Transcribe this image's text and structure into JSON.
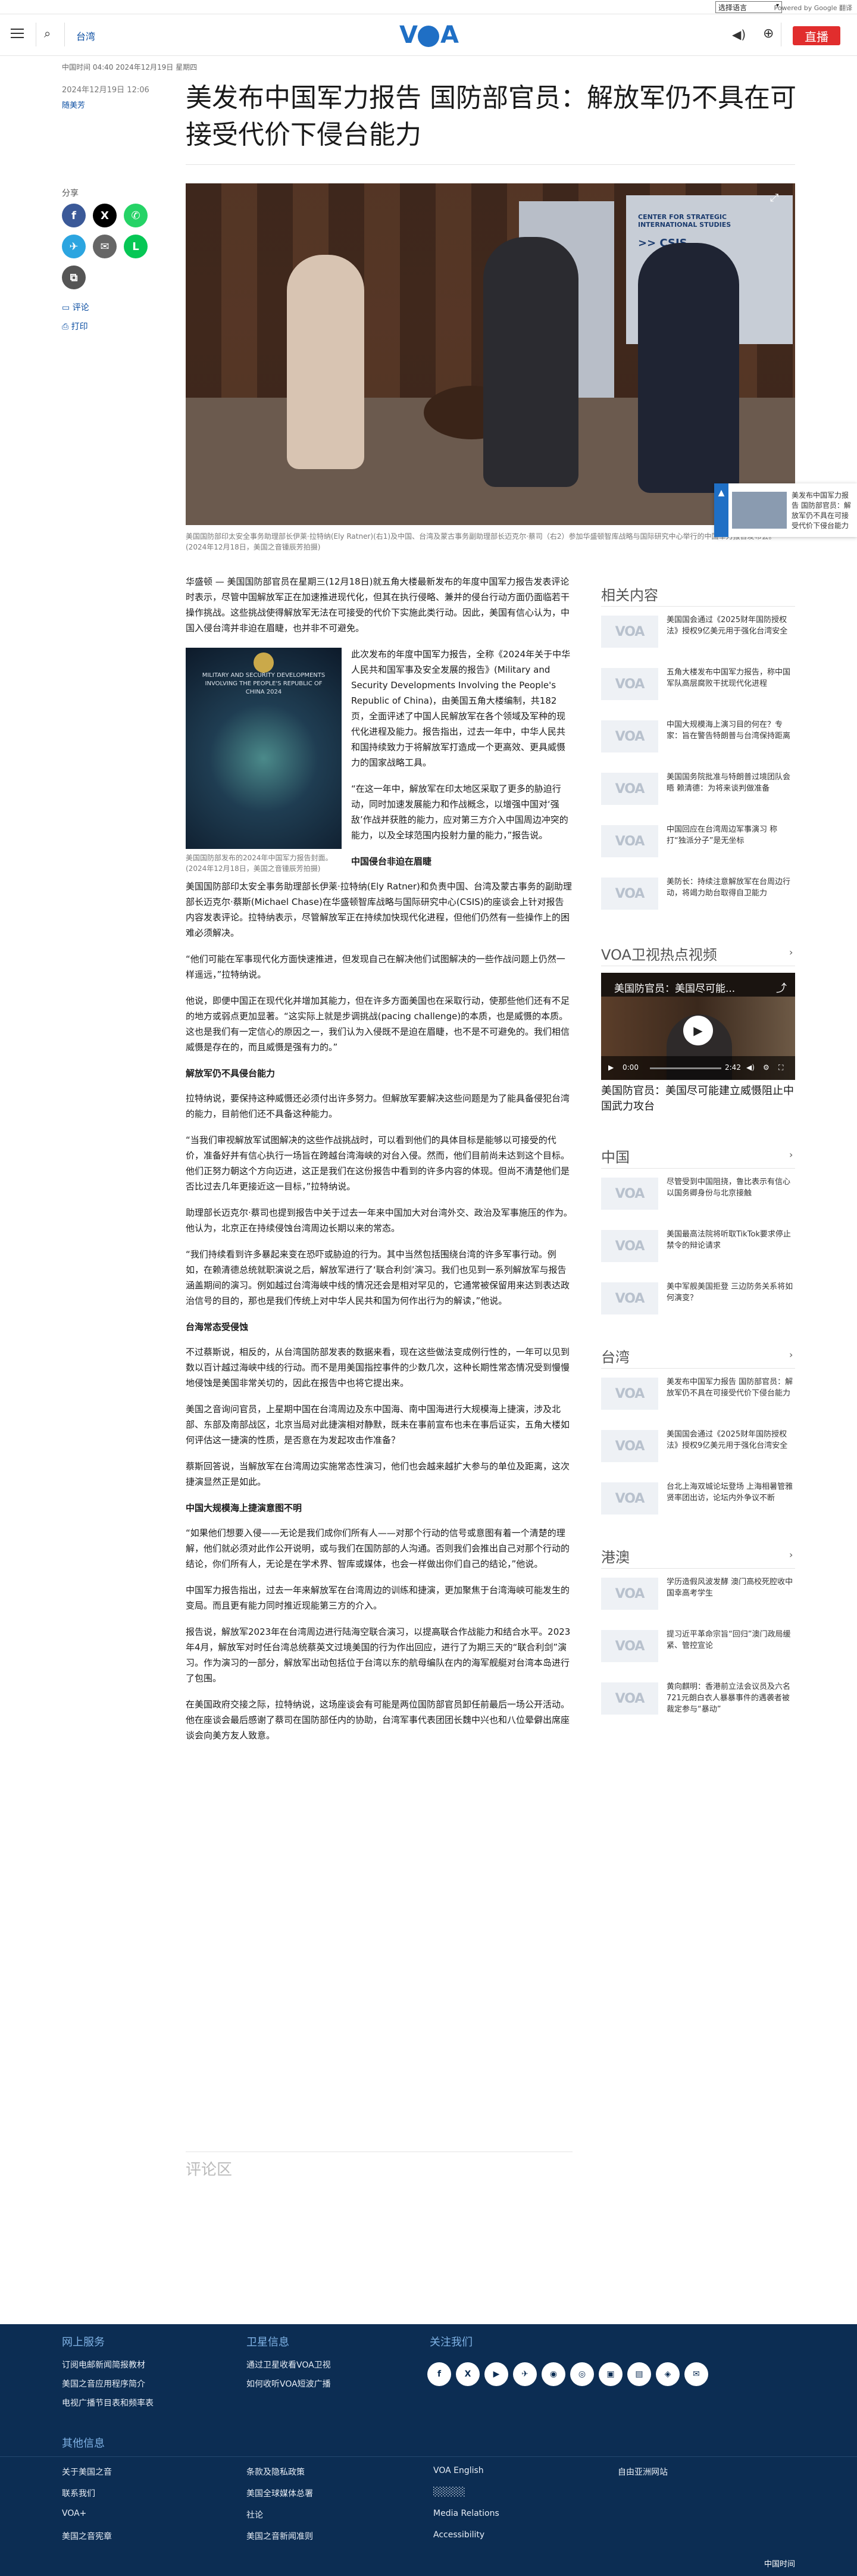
{
  "lang": {
    "selected": "选择语言",
    "powered": "Powered by Google 翻译"
  },
  "header": {
    "section": "台湾",
    "logo": "VOA",
    "live": "直播"
  },
  "meta": {
    "date_line": "中国时间 04:40 2024年12月19日 星期四",
    "published": "2024年12月19日 12:06",
    "author": "随美芳"
  },
  "title": "美发布中国军力报告 国防部官员：解放军仍不具在可接受代价下侵台能力",
  "share": {
    "label": "分享",
    "comment": "评论",
    "print": "打印"
  },
  "hero": {
    "caption": "美国国防部印太安全事务助理部长伊莱·拉特纳(Ely Ratner)(右1)及中国、台湾及蒙古事务副助理部长迈克尔·蔡司（右2）参加华盛顿智库战略与国际研究中心举行的中国军力报告发布会。(2024年12月18日，美国之音锺辰芳拍摄)",
    "banner_text": ">> CSIS",
    "banner_sub": "CENTER FOR STRATEGIC INTERNATIONAL STUDIES"
  },
  "floating": {
    "text": "美发布中国军力报告 国防部官员：解放军仍不具在可接受代价下侵台能力"
  },
  "inline_image": {
    "cover_text": "MILITARY AND SECURITY DEVELOPMENTS INVOLVING THE PEOPLE'S REPUBLIC OF CHINA 2024",
    "caption": "美国国防部发布的2024年中国军力报告封面。(2024年12月18日，美国之音锺辰芳拍摄)"
  },
  "article": {
    "p1": "华盛顿 — 美国国防部官员在星期三(12月18日)就五角大楼最新发布的年度中国军力报告发表评论时表示，尽管中国解放军正在加速推进现代化，但其在执行侵略、兼并的侵台行动方面仍面临若干操作挑战。这些挑战使得解放军无法在可接受的代价下实施此类行动。因此，美国有信心认为，中国入侵台湾并非迫在眉睫，也并非不可避免。",
    "p2": "此次发布的年度中国军力报告，全称《2024年关于中华人民共和国军事及安全发展的报告》(Military and Security Developments Involving the People's Republic of China)，由美国五角大楼编制，共182页，全面评述了中国人民解放军在各个领域及军种的现代化进程及能力。报告指出，过去一年中，中华人民共和国持续致力于将解放军打造成一个更高效、更具威慑力的国家战略工具。",
    "p3": "“在这一年中，解放军在印太地区采取了更多的胁迫行动，同时加速发展能力和作战概念，以增强中国对‘强敌’作战并获胜的能力，应对第三方介入中国周边冲突的能力，以及全球范围内投射力量的能力，”报告说。",
    "h1": "中国侵台非迫在眉睫",
    "p4": "美国国防部印太安全事务助理部长伊莱·拉特纳(Ely Ratner)和负责中国、台湾及蒙古事务的副助理部长迈克尔·蔡斯(Michael Chase)在华盛顿智库战略与国际研究中心(CSIS)的座谈会上针对报告内容发表评论。拉特纳表示，尽管解放军正在持续加快现代化进程，但他们仍然有一些操作上的困难必须解决。",
    "p5": "“他们可能在军事现代化方面快速推进，但发现自己在解决他们试图解决的一些作战问题上仍然一样遥远，”拉特纳说。",
    "p6": "他说，即便中国正在现代化并增加其能力，但在许多方面美国也在采取行动，使那些他们还有不足的地方或弱点更加显著。“这实际上就是步调挑战(pacing challenge)的本质，也是威慑的本质。这也是我们有一定信心的原因之一，我们认为入侵既不是迫在眉睫，也不是不可避免的。我们相信威慑是存在的，而且威慑是强有力的。”",
    "h2": "解放军仍不具侵台能力",
    "p7": "拉特纳说，要保持这种威慑还必须付出许多努力。但解放军要解决这些问题是为了能具备侵犯台湾的能力，目前他们还不具备这种能力。",
    "p8": "“当我们审视解放军试图解决的这些作战挑战时，可以看到他们的具体目标是能够以可接受的代价，准备好并有信心执行一场旨在跨越台湾海峡的对台入侵。然而，他们目前尚未达到这个目标。他们正努力朝这个方向迈进，这正是我们在这份报告中看到的许多内容的体现。但尚不清楚他们是否比过去几年更接近这一目标，”拉特纳说。",
    "p9": "助理部长迈克尔·蔡司也提到报告中关于过去一年来中国加大对台湾外交、政治及军事施压的作为。他认为，北京正在持续侵蚀台湾周边长期以来的常态。",
    "p10": "“我们持续看到许多暴起来变在恐吓或胁迫的行为。其中当然包括围绕台湾的许多军事行动。例如，在赖清德总统就职演说之后，解放军进行了‘联合利剑’演习。我们也见到一系列解放军与报告涵盖期间的演习。例如越过台湾海峡中线的情况还会是相对罕见的，它通常被保留用来达到表达政治信号的目的，那也是我们传统上对中华人民共和国为何作出行为的解读，”他说。",
    "h3": "台海常态受侵蚀",
    "p11": "不过蔡斯说，相反的，从台湾国防部发表的数据来看，现在这些做法变成例行性的，一年可以见到数以百计越过海峡中线的行动。而不是用美国指控事件的少数几次，这种长期性常态情况受到慢慢地侵蚀是美国非常关切的，因此在报告中也将它提出来。",
    "p12": "美国之音询问官员，上星期中国在台湾周边及东中国海、南中国海进行大规模海上捷演，涉及北部、东部及南部战区，北京当局对此捷演相对静默，既未在事前宣布也未在事后证实，五角大楼如何评估这一捷演的性质，是否意在为发起攻击作准备？",
    "p13": "蔡斯回答说，当解放军在台湾周边实施常态性演习，他们也会越来越扩大参与的单位及距离，这次捷演显然正是如此。",
    "h4": "中国大规模海上捷演意图不明",
    "p14": "“如果他们想要入侵——无论是我们成你们所有人——对那个行动的信号或意图有着一个清楚的理解，他们就必须对此作公开说明，或与我们在国防部的人沟通。否则我们会推出自己对那个行动的结论，你们所有人，无论是在学术界、智库或媒体，也会一样做出你们自己的结论，”他说。",
    "p15": "中国军力报告指出，过去一年来解放军在台湾周边的训练和捷演，更加聚焦于台湾海峡可能发生的变局。而且更有能力同时推近现能第三方的介入。",
    "p16": "报告说，解放军2023年在台湾周边进行陆海空联合演习，以提高联合作战能力和结合水平。2023年4月，解放军对时任台湾总统蔡英文过境美国的行为作出回应，进行了为期三天的“联合利剑”演习。作为演习的一部分，解放军出动包括位于台湾以东的航母编队在内的海军舰艇对台湾本岛进行了包围。",
    "p17": "在美国政府交接之际，拉特纳说，这场座谈会有可能是两位国防部官员卸任前最后一场公开活动。他在座谈会最后感谢了蔡司在国防部任内的协助，台湾军事代表团团长魏中兴也和八位晕僻出席座谈会向美方友人致意。"
  },
  "comments": {
    "label": "评论区"
  },
  "sidebar": {
    "related_head": "相关内容",
    "related": [
      "美国国会通过《2025财年国防授权法》授权9亿美元用于强化台湾安全",
      "五角大楼发布中国军力报告，称中国军队高层腐败干扰现代化进程",
      "中国大规模海上演习目的何在？专家：旨在警告特朗普与台湾保持距离",
      "美国国务院批准与特朗普过境团队会晤 赖清德：为将来谈判做准备",
      "中国回应在台湾周边军事演习 称打“独派分子”是无坐标",
      "美防长：持续注意解放军在台周边行动，将竭力助台取得自卫能力"
    ],
    "video_head": "VOA卫视热点视频",
    "video_title": "美国防官员：美国尽可能...",
    "video_time": "0:00",
    "video_duration": "2:42",
    "video_caption": "美国防官员：美国尽可能建立威慑阻止中国武力攻台",
    "china_head": "中国",
    "china": [
      "尽管受到中国阻挠，鲁比表示有信心以国务卿身份与北京接触",
      "美国最高法院将听取TikTok要求停止禁令的辩论请求",
      "美中军舰美国拒登 三边防务关系将如何演变？"
    ],
    "taiwan_head": "台湾",
    "taiwan": [
      "美发布中国军力报告 国防部官员：解放军仍不具在可接受代价下侵台能力",
      "美国国会通过《2025财年国防授权法》授权9亿美元用于强化台湾安全",
      "台北上海双城论坛登场 上海相暑管雅贤率团出访，论坛内外争议不断"
    ],
    "hk_head": "港澳",
    "hk": [
      "学历造假风波发酵 澳门高校死腔收中国幸高考学生",
      "提习近平革命宗旨“回归”澳门政局缓紧、管控宣论",
      "黄向麒明：香港前立法会议员及六名721元朗白衣人暴暴事件的遇袭者被裁定参与“暴动”"
    ]
  },
  "footer": {
    "col1_head": "网上服务",
    "col1": [
      "订阅电邮新闻简报教材",
      "美国之音应用程序简介",
      "电视广播节目表和频率表"
    ],
    "col2_head": "卫星信息",
    "col2": [
      "通过卫星收看VOA卫视",
      "如何收听VOA短波广播"
    ],
    "col3_head": "关注我们",
    "social": [
      "f",
      "X",
      "▶",
      "✈",
      "◉",
      "◎",
      "▣",
      "▤",
      "◈",
      "✉"
    ],
    "more_head": "其他信息",
    "more": [
      [
        "关于美国之音",
        "条款及隐私政策",
        "VOA English",
        "自由亚洲网站"
      ],
      [
        "联系我们",
        "美国全球媒体总署",
        "░░░░░",
        ""
      ],
      [
        "VOA+",
        "社论",
        "Media Relations",
        ""
      ],
      [
        "美国之音宪章",
        "美国之音新闻准则",
        "Accessibility",
        ""
      ]
    ],
    "copyright": "中国时间"
  }
}
